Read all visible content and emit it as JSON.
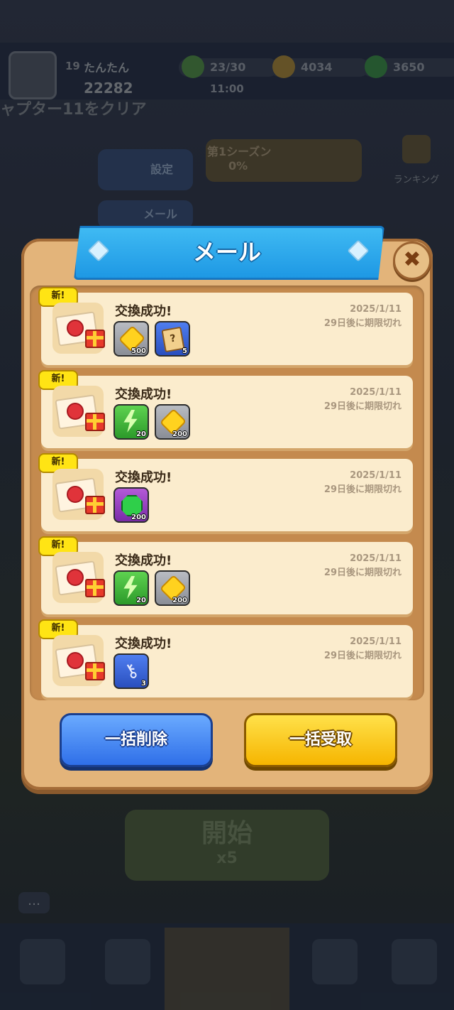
{
  "background": {
    "player_level": "19",
    "player_name": "たんたん",
    "player_score": "22282",
    "time": "11:00",
    "energy": "23/30",
    "coins": "4034",
    "gems": "3650",
    "chapter": "ャプター11をクリア",
    "settings_label": "設定",
    "mail_label": "メール",
    "season_label": "第1シーズン",
    "season_progress": "0%",
    "ranking_label": "ランキング",
    "start_label": "開始",
    "start_cost": "x5",
    "chat_icon": "…"
  },
  "modal": {
    "title": "メール",
    "close_icon": "✖",
    "delete_all_label": "一括削除",
    "claim_all_label": "一括受取",
    "mails": [
      {
        "badge": "新!",
        "title": "交換成功!",
        "date": "2025/1/11",
        "expire": "29日後に期限切れ",
        "rewards": [
          {
            "icon": "coin-icon",
            "amount": "500"
          },
          {
            "icon": "scroll-icon",
            "amount": "5"
          }
        ]
      },
      {
        "badge": "新!",
        "title": "交換成功!",
        "date": "2025/1/11",
        "expire": "29日後に期限切れ",
        "rewards": [
          {
            "icon": "energy-icon",
            "amount": "20"
          },
          {
            "icon": "coin-icon",
            "amount": "200"
          }
        ]
      },
      {
        "badge": "新!",
        "title": "交換成功!",
        "date": "2025/1/11",
        "expire": "29日後に期限切れ",
        "rewards": [
          {
            "icon": "gem-icon",
            "amount": "200"
          }
        ]
      },
      {
        "badge": "新!",
        "title": "交換成功!",
        "date": "2025/1/11",
        "expire": "29日後に期限切れ",
        "rewards": [
          {
            "icon": "energy-icon",
            "amount": "20"
          },
          {
            "icon": "coin-icon",
            "amount": "200"
          }
        ]
      },
      {
        "badge": "新!",
        "title": "交換成功!",
        "date": "2025/1/11",
        "expire": "29日後に期限切れ",
        "rewards": [
          {
            "icon": "key-icon",
            "amount": "3"
          }
        ]
      }
    ]
  },
  "colors": {
    "ribbon_blue": "#2aa6ee",
    "panel_wood": "#e3b47a",
    "card_cream": "#fbeccd",
    "delete_blue": "#3f82f0",
    "claim_yellow": "#fbc81c",
    "new_badge": "#ffe414"
  }
}
